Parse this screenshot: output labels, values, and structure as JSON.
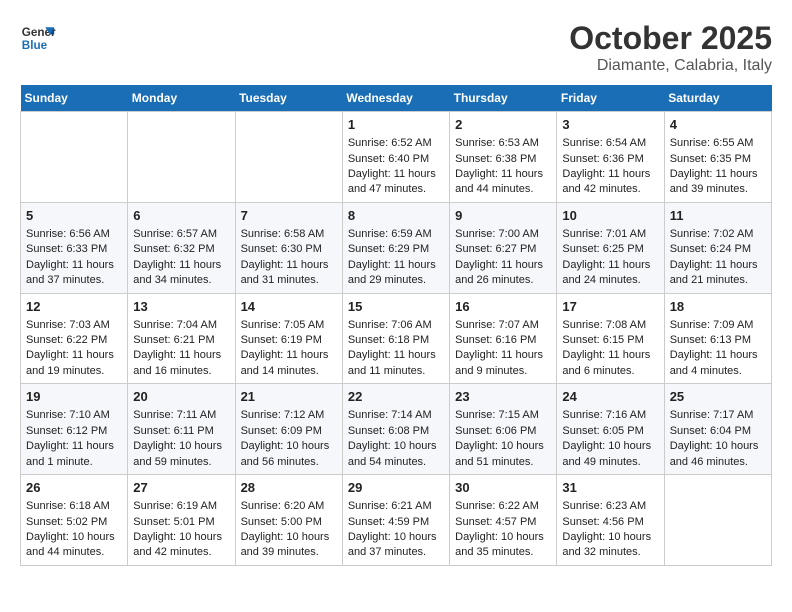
{
  "logo": {
    "line1": "General",
    "line2": "Blue"
  },
  "title": "October 2025",
  "subtitle": "Diamante, Calabria, Italy",
  "weekdays": [
    "Sunday",
    "Monday",
    "Tuesday",
    "Wednesday",
    "Thursday",
    "Friday",
    "Saturday"
  ],
  "weeks": [
    [
      {
        "day": "",
        "info": ""
      },
      {
        "day": "",
        "info": ""
      },
      {
        "day": "",
        "info": ""
      },
      {
        "day": "1",
        "info": "Sunrise: 6:52 AM\nSunset: 6:40 PM\nDaylight: 11 hours and 47 minutes."
      },
      {
        "day": "2",
        "info": "Sunrise: 6:53 AM\nSunset: 6:38 PM\nDaylight: 11 hours and 44 minutes."
      },
      {
        "day": "3",
        "info": "Sunrise: 6:54 AM\nSunset: 6:36 PM\nDaylight: 11 hours and 42 minutes."
      },
      {
        "day": "4",
        "info": "Sunrise: 6:55 AM\nSunset: 6:35 PM\nDaylight: 11 hours and 39 minutes."
      }
    ],
    [
      {
        "day": "5",
        "info": "Sunrise: 6:56 AM\nSunset: 6:33 PM\nDaylight: 11 hours and 37 minutes."
      },
      {
        "day": "6",
        "info": "Sunrise: 6:57 AM\nSunset: 6:32 PM\nDaylight: 11 hours and 34 minutes."
      },
      {
        "day": "7",
        "info": "Sunrise: 6:58 AM\nSunset: 6:30 PM\nDaylight: 11 hours and 31 minutes."
      },
      {
        "day": "8",
        "info": "Sunrise: 6:59 AM\nSunset: 6:29 PM\nDaylight: 11 hours and 29 minutes."
      },
      {
        "day": "9",
        "info": "Sunrise: 7:00 AM\nSunset: 6:27 PM\nDaylight: 11 hours and 26 minutes."
      },
      {
        "day": "10",
        "info": "Sunrise: 7:01 AM\nSunset: 6:25 PM\nDaylight: 11 hours and 24 minutes."
      },
      {
        "day": "11",
        "info": "Sunrise: 7:02 AM\nSunset: 6:24 PM\nDaylight: 11 hours and 21 minutes."
      }
    ],
    [
      {
        "day": "12",
        "info": "Sunrise: 7:03 AM\nSunset: 6:22 PM\nDaylight: 11 hours and 19 minutes."
      },
      {
        "day": "13",
        "info": "Sunrise: 7:04 AM\nSunset: 6:21 PM\nDaylight: 11 hours and 16 minutes."
      },
      {
        "day": "14",
        "info": "Sunrise: 7:05 AM\nSunset: 6:19 PM\nDaylight: 11 hours and 14 minutes."
      },
      {
        "day": "15",
        "info": "Sunrise: 7:06 AM\nSunset: 6:18 PM\nDaylight: 11 hours and 11 minutes."
      },
      {
        "day": "16",
        "info": "Sunrise: 7:07 AM\nSunset: 6:16 PM\nDaylight: 11 hours and 9 minutes."
      },
      {
        "day": "17",
        "info": "Sunrise: 7:08 AM\nSunset: 6:15 PM\nDaylight: 11 hours and 6 minutes."
      },
      {
        "day": "18",
        "info": "Sunrise: 7:09 AM\nSunset: 6:13 PM\nDaylight: 11 hours and 4 minutes."
      }
    ],
    [
      {
        "day": "19",
        "info": "Sunrise: 7:10 AM\nSunset: 6:12 PM\nDaylight: 11 hours and 1 minute."
      },
      {
        "day": "20",
        "info": "Sunrise: 7:11 AM\nSunset: 6:11 PM\nDaylight: 10 hours and 59 minutes."
      },
      {
        "day": "21",
        "info": "Sunrise: 7:12 AM\nSunset: 6:09 PM\nDaylight: 10 hours and 56 minutes."
      },
      {
        "day": "22",
        "info": "Sunrise: 7:14 AM\nSunset: 6:08 PM\nDaylight: 10 hours and 54 minutes."
      },
      {
        "day": "23",
        "info": "Sunrise: 7:15 AM\nSunset: 6:06 PM\nDaylight: 10 hours and 51 minutes."
      },
      {
        "day": "24",
        "info": "Sunrise: 7:16 AM\nSunset: 6:05 PM\nDaylight: 10 hours and 49 minutes."
      },
      {
        "day": "25",
        "info": "Sunrise: 7:17 AM\nSunset: 6:04 PM\nDaylight: 10 hours and 46 minutes."
      }
    ],
    [
      {
        "day": "26",
        "info": "Sunrise: 6:18 AM\nSunset: 5:02 PM\nDaylight: 10 hours and 44 minutes."
      },
      {
        "day": "27",
        "info": "Sunrise: 6:19 AM\nSunset: 5:01 PM\nDaylight: 10 hours and 42 minutes."
      },
      {
        "day": "28",
        "info": "Sunrise: 6:20 AM\nSunset: 5:00 PM\nDaylight: 10 hours and 39 minutes."
      },
      {
        "day": "29",
        "info": "Sunrise: 6:21 AM\nSunset: 4:59 PM\nDaylight: 10 hours and 37 minutes."
      },
      {
        "day": "30",
        "info": "Sunrise: 6:22 AM\nSunset: 4:57 PM\nDaylight: 10 hours and 35 minutes."
      },
      {
        "day": "31",
        "info": "Sunrise: 6:23 AM\nSunset: 4:56 PM\nDaylight: 10 hours and 32 minutes."
      },
      {
        "day": "",
        "info": ""
      }
    ]
  ]
}
